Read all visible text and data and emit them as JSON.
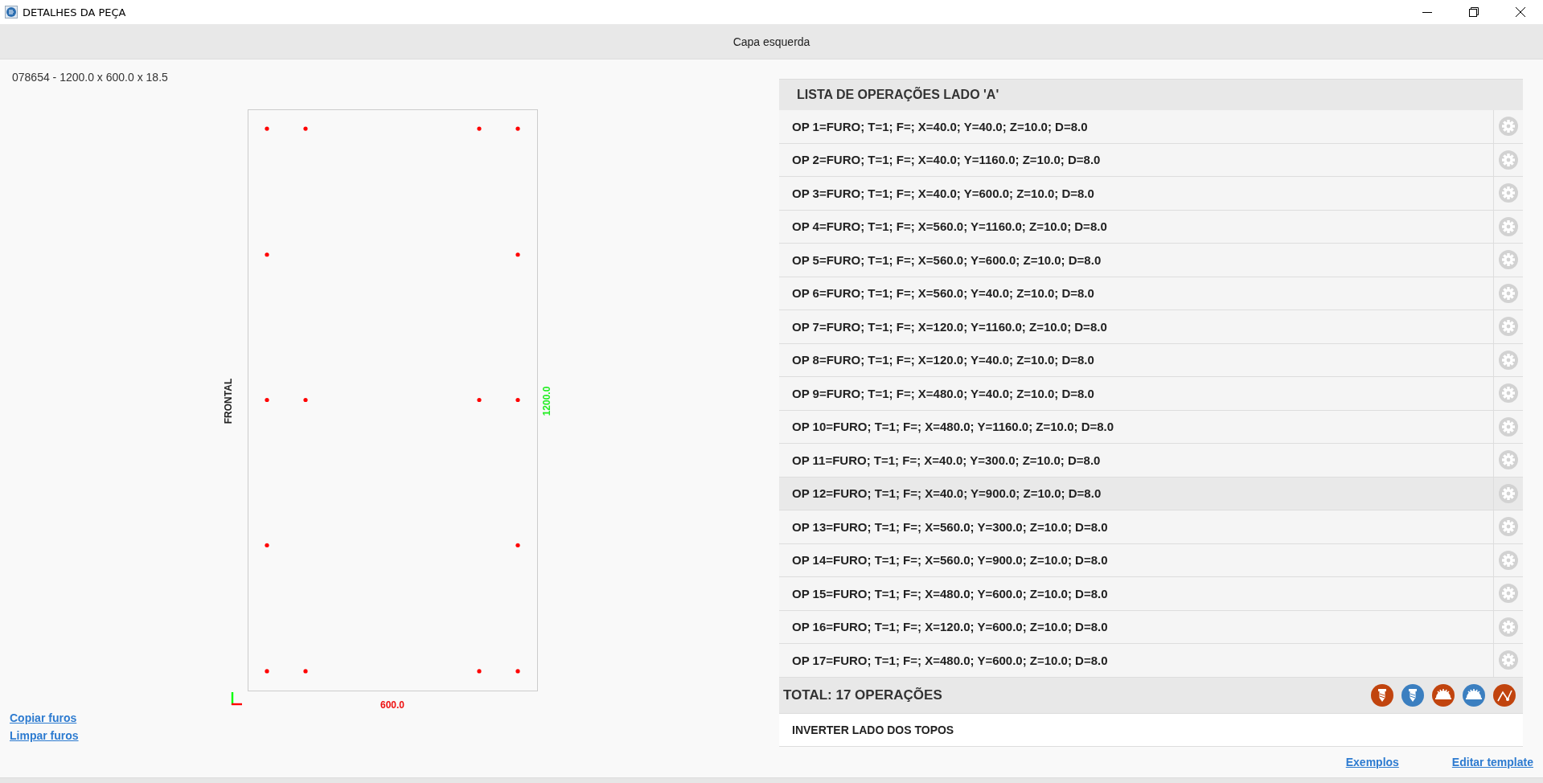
{
  "window": {
    "title": "DETALHES DA PEÇA"
  },
  "header": {
    "title": "Capa esquerda"
  },
  "piece": {
    "info": "078654 - 1200.0 x 600.0 x 18.5",
    "side_label": "FRONTAL",
    "height_label": "1200.0",
    "width_label": "600.0"
  },
  "links_left": [
    "Copiar furos",
    "Limpar furos"
  ],
  "operations": {
    "title": "LISTA DE OPERAÇÕES LADO 'A'",
    "items": [
      {
        "label": "OP 1=FURO; T=1; F=; X=40.0; Y=40.0; Z=10.0; D=8.0",
        "selected": false
      },
      {
        "label": "OP 2=FURO; T=1; F=; X=40.0; Y=1160.0; Z=10.0; D=8.0",
        "selected": false
      },
      {
        "label": "OP 3=FURO; T=1; F=; X=40.0; Y=600.0; Z=10.0; D=8.0",
        "selected": false
      },
      {
        "label": "OP 4=FURO; T=1; F=; X=560.0; Y=1160.0; Z=10.0; D=8.0",
        "selected": false
      },
      {
        "label": "OP 5=FURO; T=1; F=; X=560.0; Y=600.0; Z=10.0; D=8.0",
        "selected": false
      },
      {
        "label": "OP 6=FURO; T=1; F=; X=560.0; Y=40.0; Z=10.0; D=8.0",
        "selected": false
      },
      {
        "label": "OP 7=FURO; T=1; F=; X=120.0; Y=1160.0; Z=10.0; D=8.0",
        "selected": false
      },
      {
        "label": "OP 8=FURO; T=1; F=; X=120.0; Y=40.0; Z=10.0; D=8.0",
        "selected": false
      },
      {
        "label": "OP 9=FURO; T=1; F=; X=480.0; Y=40.0; Z=10.0; D=8.0",
        "selected": false
      },
      {
        "label": "OP 10=FURO; T=1; F=; X=480.0; Y=1160.0; Z=10.0; D=8.0",
        "selected": false
      },
      {
        "label": "OP 11=FURO; T=1; F=; X=40.0; Y=300.0; Z=10.0; D=8.0",
        "selected": false
      },
      {
        "label": "OP 12=FURO; T=1; F=; X=40.0; Y=900.0; Z=10.0; D=8.0",
        "selected": true
      },
      {
        "label": "OP 13=FURO; T=1; F=; X=560.0; Y=300.0; Z=10.0; D=8.0",
        "selected": false
      },
      {
        "label": "OP 14=FURO; T=1; F=; X=560.0; Y=900.0; Z=10.0; D=8.0",
        "selected": false
      },
      {
        "label": "OP 15=FURO; T=1; F=; X=480.0; Y=600.0; Z=10.0; D=8.0",
        "selected": false
      },
      {
        "label": "OP 16=FURO; T=1; F=; X=120.0; Y=600.0; Z=10.0; D=8.0",
        "selected": false
      },
      {
        "label": "OP 17=FURO; T=1; F=; X=480.0; Y=600.0; Z=10.0; D=8.0",
        "selected": false
      }
    ],
    "total": "TOTAL: 17 OPERAÇÕES",
    "tools": [
      {
        "kind": "drill",
        "color": "#c1440e"
      },
      {
        "kind": "drill",
        "color": "#3b7fc0"
      },
      {
        "kind": "saw",
        "color": "#c1440e"
      },
      {
        "kind": "saw",
        "color": "#3b7fc0"
      },
      {
        "kind": "path",
        "color": "#c1440e"
      }
    ],
    "option": "INVERTER LADO DOS TOPOS"
  },
  "links_right": [
    "Exemplos",
    "Editar template"
  ]
}
